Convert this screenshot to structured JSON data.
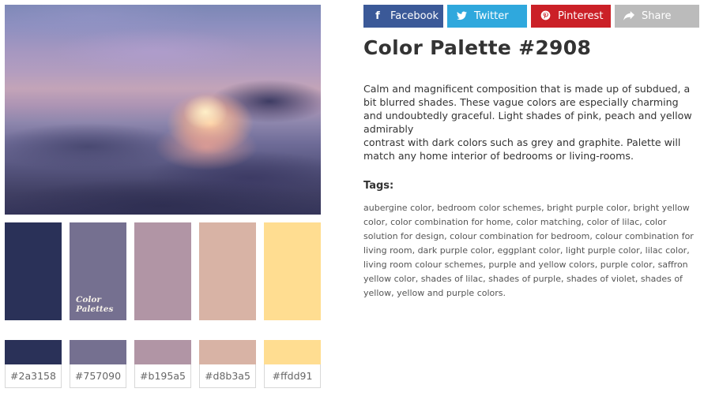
{
  "share": {
    "facebook": "Facebook",
    "twitter": "Twitter",
    "pinterest": "Pinterest",
    "share": "Share"
  },
  "colors": {
    "facebook": "#3b5998",
    "twitter": "#2fa8dd",
    "pinterest": "#cb2027",
    "share": "#bbbbbb"
  },
  "palette": {
    "title": "Color Palette #2908",
    "description_lines": [
      "Calm and magnificent composition that is made up of subdued, a bit blurred shades. These vague colors are especially charming and undoubtedly graceful. Light shades of pink, peach and yellow admirably",
      "contrast with dark colors such as grey and graphite. Palette will match any home interior of bedrooms or living-rooms."
    ],
    "tags_heading": "Tags:",
    "tags": "aubergine color, bedroom color schemes, bright purple color, bright yellow color, color combination for home, color matching, color of lilac, color solution for design, colour combination for bedroom, colour combination for living room, dark purple color, eggplant color, light purple color, lilac color, living room colour schemes, purple and yellow colors, purple color, saffron yellow color, shades of lilac, shades of purple, shades of violet, shades of yellow, yellow and purple colors.",
    "logo_line1": "Color",
    "logo_line2": "Palettes",
    "swatches": [
      {
        "hex": "#2a3158",
        "label": "#2a3158"
      },
      {
        "hex": "#757090",
        "label": "#757090"
      },
      {
        "hex": "#b195a5",
        "label": "#b195a5"
      },
      {
        "hex": "#d8b3a5",
        "label": "#d8b3a5"
      },
      {
        "hex": "#ffdd91",
        "label": "#ffdd91"
      }
    ]
  }
}
